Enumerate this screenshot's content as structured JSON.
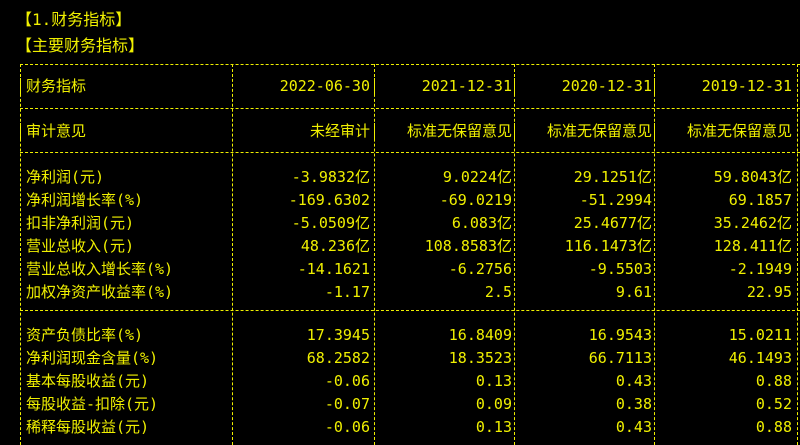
{
  "titles": {
    "section": "【1.财务指标】",
    "subsection": "【主要财务指标】"
  },
  "header": {
    "label": "财务指标",
    "dates": [
      "2022-06-30",
      "2021-12-31",
      "2020-12-31",
      "2019-12-31"
    ]
  },
  "audit": {
    "label": "审计意见",
    "values": [
      "未经审计",
      "标准无保留意见",
      "标准无保留意见",
      "标准无保留意见"
    ]
  },
  "group1": [
    {
      "label": "净利润(元)",
      "values": [
        "-3.9832亿",
        "9.0224亿",
        "29.1251亿",
        "59.8043亿"
      ]
    },
    {
      "label": "净利润增长率(%)",
      "values": [
        "-169.6302",
        "-69.0219",
        "-51.2994",
        "69.1857"
      ]
    },
    {
      "label": "扣非净利润(元)",
      "values": [
        "-5.0509亿",
        "6.083亿",
        "25.4677亿",
        "35.2462亿"
      ]
    },
    {
      "label": "营业总收入(元)",
      "values": [
        "48.236亿",
        "108.8583亿",
        "116.1473亿",
        "128.411亿"
      ]
    },
    {
      "label": "营业总收入增长率(%)",
      "values": [
        "-14.1621",
        "-6.2756",
        "-9.5503",
        "-2.1949"
      ]
    },
    {
      "label": "加权净资产收益率(%)",
      "values": [
        "-1.17",
        "2.5",
        "9.61",
        "22.95"
      ]
    }
  ],
  "group2": [
    {
      "label": "资产负债比率(%)",
      "values": [
        "17.3945",
        "16.8409",
        "16.9543",
        "15.0211"
      ]
    },
    {
      "label": "净利润现金含量(%)",
      "values": [
        "68.2582",
        "18.3523",
        "66.7113",
        "46.1493"
      ]
    },
    {
      "label": "基本每股收益(元)",
      "values": [
        "-0.06",
        "0.13",
        "0.43",
        "0.88"
      ]
    },
    {
      "label": "每股收益-扣除(元)",
      "values": [
        "-0.07",
        "0.09",
        "0.38",
        "0.52"
      ]
    },
    {
      "label": "稀释每股收益(元)",
      "values": [
        "-0.06",
        "0.13",
        "0.43",
        "0.88"
      ]
    }
  ]
}
